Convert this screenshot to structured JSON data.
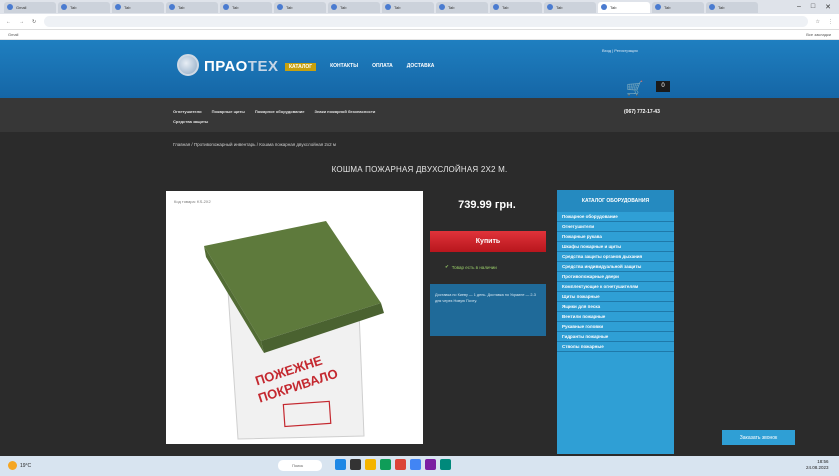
{
  "browser": {
    "tabs": [
      "Gmail",
      "Tab",
      "Tab",
      "Tab",
      "Tab",
      "Tab",
      "Tab",
      "Tab",
      "Tab",
      "Tab",
      "Tab",
      "Tab",
      "Tab",
      "Tab"
    ],
    "url": "",
    "bookmarks_left": "Gmail",
    "bookmarks_right": "Все закладки"
  },
  "site": {
    "brand_main": "ПРАО",
    "brand_accent": "ТЕХ",
    "nav": [
      "КАТАЛОГ",
      "КОНТАКТЫ",
      "ОПЛАТА",
      "ДОСТАВКА"
    ],
    "login_text": "Вход | Регистрация",
    "cart_count": "0",
    "phone": "(067) 772-17-43",
    "menu_row1": [
      "Огнетушители",
      "Пожарные щиты",
      "Пожарное оборудование",
      "Знаки пожарной безопасности"
    ],
    "menu_row2": [
      "Средства защиты"
    ],
    "breadcrumb": "Главная / Противопожарный инвентарь / Кошма пожарная двухслойная 2х2 м",
    "title": "КОШМА ПОЖАРНАЯ ДВУХСЛОЙНАЯ 2Х2 М.",
    "photo_caption": "Код товара: KS-2X2",
    "price": "739.99 грн.",
    "buy_label": "Купить",
    "stock_label": "Товар есть в наличии",
    "info_text": "Доставка по Киеву — 1 день. Доставка по Украине — 2-3 дня через Новую Почту.",
    "catalog_title": "КАТАЛОГ ОБОРУДОВАНИЯ",
    "catalog_items": [
      "Пожарное оборудование",
      "Огнетушители",
      "Пожарные рукава",
      "Шкафы пожарные и щиты",
      "Средства защиты органов дыхания",
      "Средства индивидуальной защиты",
      "Противопожарные двери",
      "Комплектующие к огнетушителям",
      "Щиты пожарные",
      "Ящики для песка",
      "Вентили пожарные",
      "Рукавные головки",
      "Гидранты пожарные",
      "Стволы пожарные"
    ],
    "callback_label": "Заказать звонок"
  },
  "taskbar": {
    "weather": "19°C",
    "search": "Поиск",
    "time": "18:56",
    "date": "24.08.2023"
  }
}
